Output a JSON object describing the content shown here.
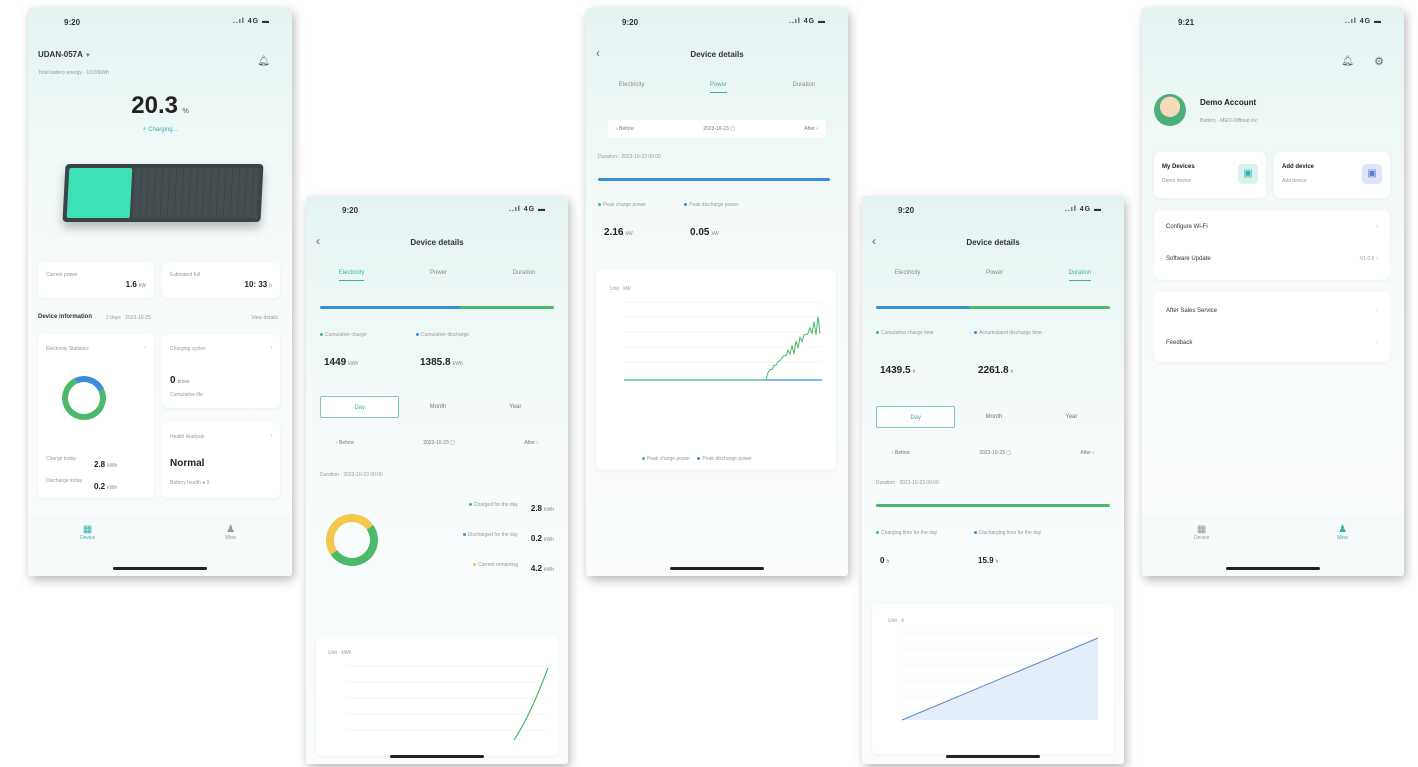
{
  "status": {
    "t1": "9:20",
    "t2": "9:20",
    "t3": "9:20",
    "t4": "9:20",
    "t5": "9:21",
    "icons": "..ıl 4G ▬"
  },
  "home": {
    "device_name": "UDAN-057A",
    "device_arrow": "▼",
    "subtitle": "Total battery energy · 10.08kWh",
    "soc": "20.3",
    "soc_unit": "%",
    "soc_level": 0.203,
    "state": "Charging...",
    "stat1_label": "Current power",
    "stat1_value": "1.6",
    "stat1_unit": "kW",
    "stat2_label": "Estimated full",
    "stat2_value": "10: 33",
    "stat2_unit": "h",
    "info_title": "Device information",
    "info_sub": "2 days · 2023-10-25",
    "info_more": "View details",
    "elec_title": "Electricity Statistics",
    "charge_label": "Charge today",
    "charge_value": "2.8",
    "charge_unit": "kWh",
    "discharge_label": "Discharge today",
    "discharge_value": "0.2",
    "discharge_unit": "kWh",
    "cycle_title": "Charging cycles",
    "cycle_value": "0",
    "cycle_unit": "times",
    "cycle_sub": "Cumulative life",
    "health_title": "Health Analysis",
    "health_value": "Normal",
    "health_sub": "Battery health ● 0",
    "nav_device": "Device",
    "nav_mine": "Mine"
  },
  "details": {
    "title": "Device details",
    "tab1": "Electricity",
    "tab2": "Power",
    "tab3": "Duration",
    "back": "‹"
  },
  "elec": {
    "m1_label": "Cumulative charge",
    "m1_value": "1449",
    "m1_unit": "kWh",
    "m2_label": "Cumulative discharge",
    "m2_value": "1385.8",
    "m2_unit": "kWh",
    "seg_day": "Day",
    "seg_month": "Month",
    "seg_year": "Year",
    "prev": "‹ Before",
    "date": "2023-10-23 ▢",
    "next": "After ›",
    "duration": "Duration · 2023-10-23 00:00",
    "l1_label": "Charged for the day",
    "l1_value": "2.8",
    "l1_unit": "kWh",
    "l2_label": "Discharged for the day",
    "l2_value": "0.2",
    "l2_unit": "kWh",
    "l3_label": "Current remaining",
    "l3_value": "4.2",
    "l3_unit": "kWh",
    "chart_unit": "Unit · kWh",
    "donut": [
      {
        "name": "charged",
        "value": 2.8,
        "color": "#4cb96b"
      },
      {
        "name": "discharged",
        "value": 0.2,
        "color": "#3a8ed8"
      },
      {
        "name": "remaining",
        "value": 4.2,
        "color": "#f2c94c"
      }
    ]
  },
  "power": {
    "prev": "‹ Before",
    "date": "2023-10-23 ▢",
    "next": "After ›",
    "duration": "Duration · 2023-10-23 00:00",
    "m1_label": "Peak charge power",
    "m1_value": "2.16",
    "m1_unit": "kW",
    "m2_label": "Peak discharge power",
    "m2_value": "0.05",
    "m2_unit": "kW",
    "chart_unit": "Unit · kW",
    "legend1": "Peak charge power",
    "legend2": "Peak discharge power"
  },
  "dur": {
    "m1_label": "Cumulative charge time",
    "m1_value": "1439.5",
    "m1_unit": "h",
    "m2_label": "Accumulated discharge time",
    "m2_value": "2261.8",
    "m2_unit": "h",
    "seg_day": "Day",
    "seg_month": "Month",
    "seg_year": "Year",
    "prev": "‹ Before",
    "date": "2023-10-23 ▢",
    "next": "After ›",
    "duration": "Duration · 2023-10-23 00:00",
    "d1_label": "Charging time for the day",
    "d1_value": "0",
    "d1_unit": "h",
    "d2_label": "Discharging time for the day",
    "d2_value": "15.9",
    "d2_unit": "h",
    "chart_unit": "Unit · h"
  },
  "mine": {
    "name": "Demo Account",
    "sub": "Battery · MEO-Offbeat Inc",
    "my_devices": "My Devices",
    "my_devices_sub": "Demo device",
    "add_device": "Add device",
    "add_device_sub": "Add device",
    "wifi": "Configure Wi-Fi",
    "update": "Software Update",
    "update_val": "V1.0.0",
    "after_sales": "After Sales Service",
    "feedback": "Feedback",
    "nav_device": "Device",
    "nav_mine": "Mine"
  },
  "colors": {
    "accent": "#3ab0a8",
    "green": "#4cb96b",
    "blue": "#3a8ed8",
    "yellow": "#f2c94c"
  }
}
